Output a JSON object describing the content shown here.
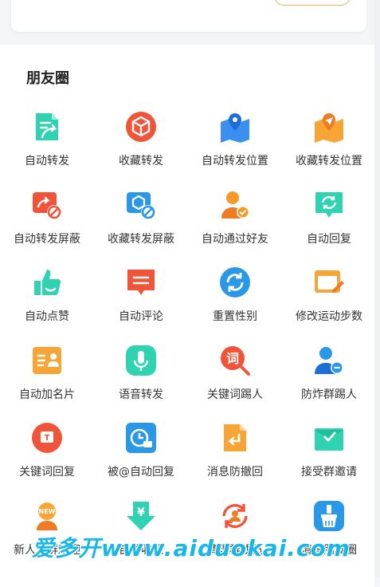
{
  "section": {
    "title": "朋友圈"
  },
  "items": [
    {
      "label": "自动转发",
      "icon": "auto-forward-icon"
    },
    {
      "label": "收藏转发",
      "icon": "favorite-forward-icon"
    },
    {
      "label": "自动转发位置",
      "icon": "auto-forward-location-icon"
    },
    {
      "label": "收藏转发位置",
      "icon": "favorite-forward-location-icon"
    },
    {
      "label": "自动转发屏蔽",
      "icon": "auto-forward-block-icon"
    },
    {
      "label": "收藏转发屏蔽",
      "icon": "favorite-forward-block-icon"
    },
    {
      "label": "自动通过好友",
      "icon": "auto-accept-friend-icon"
    },
    {
      "label": "自动回复",
      "icon": "auto-reply-icon"
    },
    {
      "label": "自动点赞",
      "icon": "auto-like-icon"
    },
    {
      "label": "自动评论",
      "icon": "auto-comment-icon"
    },
    {
      "label": "重置性别",
      "icon": "reset-gender-icon"
    },
    {
      "label": "修改运动步数",
      "icon": "edit-steps-icon"
    },
    {
      "label": "自动加名片",
      "icon": "auto-add-card-icon"
    },
    {
      "label": "语音转发",
      "icon": "voice-forward-icon"
    },
    {
      "label": "关键词踢人",
      "icon": "keyword-kick-icon"
    },
    {
      "label": "防炸群踢人",
      "icon": "anti-raid-kick-icon"
    },
    {
      "label": "关键词回复",
      "icon": "keyword-reply-icon"
    },
    {
      "label": "被@自动回复",
      "icon": "mention-auto-reply-icon"
    },
    {
      "label": "消息防撤回",
      "icon": "anti-recall-icon"
    },
    {
      "label": "接受群邀请",
      "icon": "accept-group-invite-icon"
    },
    {
      "label": "新人入群欢迎",
      "icon": "new-member-welcome-icon"
    },
    {
      "label": "自动收款",
      "icon": "auto-collect-icon"
    },
    {
      "label": "清理群成员",
      "icon": "clean-group-members-icon"
    },
    {
      "label": "清理朋友圈",
      "icon": "clean-moments-icon"
    }
  ],
  "watermark": {
    "text": "爱多开www.aiduokai.com"
  }
}
